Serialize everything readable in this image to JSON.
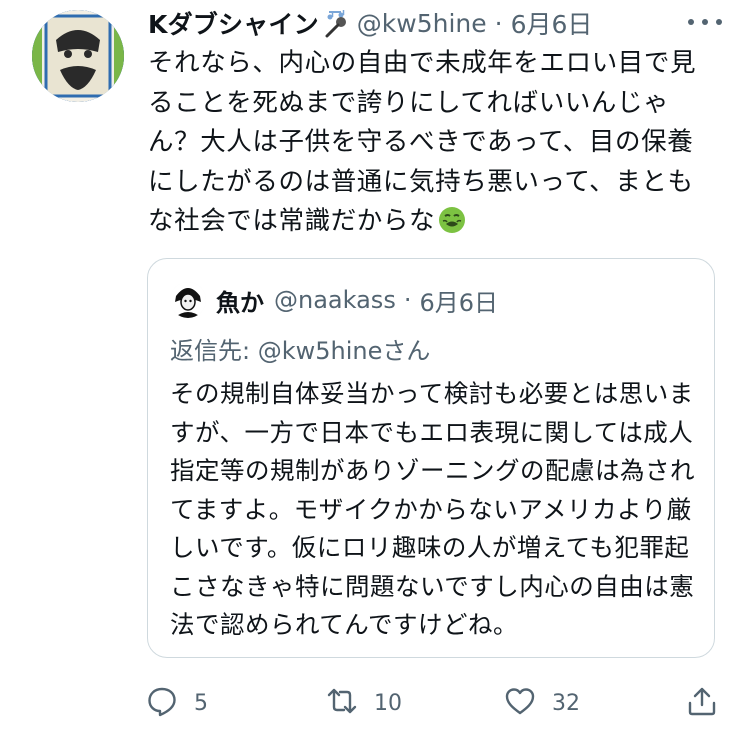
{
  "tweet": {
    "author_name": "Kダブシャイン",
    "handle": "@kw5hine",
    "separator": "·",
    "date": "6月6日",
    "text": "それなら、内心の自由で未成年をエロい目で見ることを死ぬまで誇りにしてればいいんじゃん？大人は子供を守るべきであって、目の保養にしたがるのは普通に気持ち悪いって、まともな社会では常識だからな",
    "emoji_icon": "nauseated-face-emoji"
  },
  "quote": {
    "author_name": "魚か",
    "handle": "@naakass",
    "separator": "·",
    "date": "6月6日",
    "reply_prefix": "返信先: ",
    "reply_handle": "@kw5hine",
    "reply_suffix": "さん",
    "text": "その規制自体妥当かって検討も必要とは思いますが、一方で日本でもエロ表現に関しては成人指定等の規制がありゾーニングの配慮は為されてますよ。モザイクかからないアメリカより厳しいです。仮にロリ趣味の人が増えても犯罪起こさなきゃ特に問題ないですし内心の自由は憲法で認められてんですけどね。"
  },
  "actions": {
    "reply_count": "5",
    "retweet_count": "10",
    "like_count": "32"
  },
  "colors": {
    "text": "#0f1419",
    "secondary": "#536471",
    "border": "#cfd9de"
  }
}
